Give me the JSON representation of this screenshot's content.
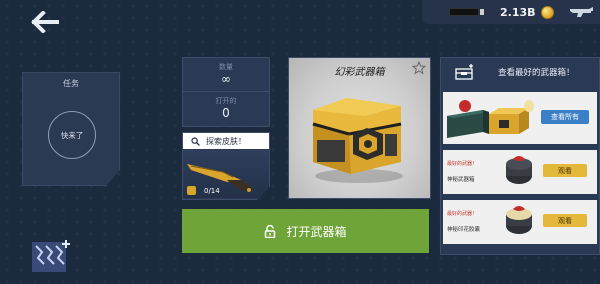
{
  "topbar": {
    "currency_amount": "2.13B"
  },
  "task": {
    "title": "任务",
    "status": "快来了"
  },
  "stats": {
    "quantity_label": "数量",
    "quantity_value": "∞",
    "opened_label": "打开的",
    "opened_value": "0"
  },
  "skin": {
    "search_label": "探索皮肤！",
    "count": "0/14"
  },
  "showcase": {
    "title": "幻彩武器箱"
  },
  "open_button": {
    "label": "打开武器箱"
  },
  "right_panel": {
    "title": "查看最好的武器箱！",
    "view_all": "查看所有",
    "rows": [
      {
        "tag": "最好的武器！",
        "name": "神秘武器箱",
        "button": "观看"
      },
      {
        "tag": "最好的武器！",
        "name": "神秘印花胶囊",
        "button": "观看"
      }
    ]
  },
  "colors": {
    "background": "#1c2a3e",
    "panel": "#2a3a55",
    "open_button": "#6ea438",
    "view_all_button": "#3b7fc7",
    "watch_button": "#e3b83b",
    "chest_gold": "#d9a52c"
  },
  "icons": {
    "back": "back-arrow-icon",
    "ammo": "ammo-icon",
    "coin": "coin-icon",
    "gun": "gun-icon",
    "star": "star-icon",
    "search": "search-icon",
    "unlock": "unlock-icon",
    "crate": "crate-icon",
    "bottom_left": "case-collection-icon"
  }
}
